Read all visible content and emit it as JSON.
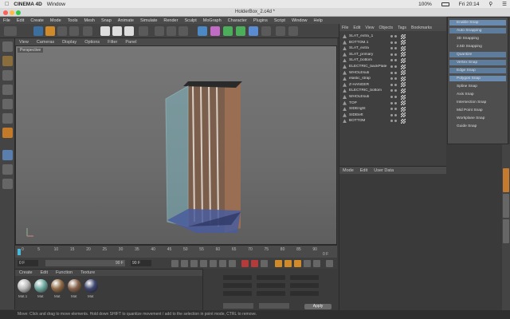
{
  "mac": {
    "app_name": "CINEMA 4D",
    "menu": "Window",
    "time": "Fri 20:14",
    "battery": "100%"
  },
  "window": {
    "title": "HolderBox_2.c4d *"
  },
  "menubar": [
    "File",
    "Edit",
    "Create",
    "Mode",
    "Tools",
    "Mesh",
    "Snap",
    "Animate",
    "Simulate",
    "Render",
    "Sculpt",
    "MoGraph",
    "Character",
    "Plugins",
    "Script",
    "Window",
    "Help"
  ],
  "viewport": {
    "menu": [
      "View",
      "Cameras",
      "Display",
      "Options",
      "Filter",
      "Panel"
    ],
    "label": "Perspective"
  },
  "timeline": {
    "ticks": [
      "0",
      "5",
      "10",
      "15",
      "20",
      "25",
      "30",
      "35",
      "40",
      "45",
      "50",
      "55",
      "60",
      "65",
      "70",
      "75",
      "80",
      "85",
      "90"
    ],
    "end_label": "0 F",
    "fields": [
      "0 F",
      "90 F",
      "90 F",
      "0 F"
    ]
  },
  "materials": {
    "menu": [
      "Create",
      "Edit",
      "Function",
      "Texture"
    ],
    "items": [
      {
        "label": "Mat.1",
        "color": "#b8b8b8"
      },
      {
        "label": "Mat",
        "color": "#6fa7a0"
      },
      {
        "label": "Mat",
        "color": "#8f6a45"
      },
      {
        "label": "Mat",
        "color": "#85614a"
      },
      {
        "label": "Mat",
        "color": "#3d466e"
      }
    ]
  },
  "coords": {
    "apply": "Apply"
  },
  "objects": {
    "menu": [
      "File",
      "Edit",
      "View",
      "Objects",
      "Tags",
      "Bookmarks"
    ],
    "rows": [
      "SLAT_extra_1",
      "BOTTOM.1",
      "SLAT_extra",
      "SLAT_primary",
      "SLAT_bottom",
      "ELECTRIC_backPlate",
      "WHOLEsub",
      "elastic_strap",
      "Z-HANGER",
      "ELECTRIC_bottom",
      "WHOLEsub",
      "TOP",
      "SIDEright",
      "SIDEleft",
      "BOTTOM"
    ]
  },
  "attributes": {
    "menu": [
      "Mode",
      "Edit",
      "User Data"
    ]
  },
  "layout_popup": {
    "items": [
      {
        "label": "Enable Snap",
        "hl": "hlb"
      },
      {
        "label": "Auto Snapping",
        "hl": "hl"
      },
      {
        "label": "3D Snapping",
        "hl": ""
      },
      {
        "label": "2.5D Snapping",
        "hl": ""
      },
      {
        "label": "Quantize",
        "hl": "hl"
      },
      {
        "label": "Vertex Snap",
        "hl": "hl"
      },
      {
        "label": "Edge Snap",
        "hl": "hl"
      },
      {
        "label": "Polygon Snap",
        "hl": "hlb"
      },
      {
        "label": "Spline Snap",
        "hl": ""
      },
      {
        "label": "Axis Snap",
        "hl": ""
      },
      {
        "label": "Intersection Snap",
        "hl": ""
      },
      {
        "label": "Mid Point Snap",
        "hl": ""
      },
      {
        "label": "Workplane Snap",
        "hl": ""
      },
      {
        "label": "Guide Snap",
        "hl": ""
      }
    ]
  },
  "status": "Move: Click and drag to move elements. Hold down SHIFT to quantize movement / add to the selection in point mode, CTRL to remove."
}
